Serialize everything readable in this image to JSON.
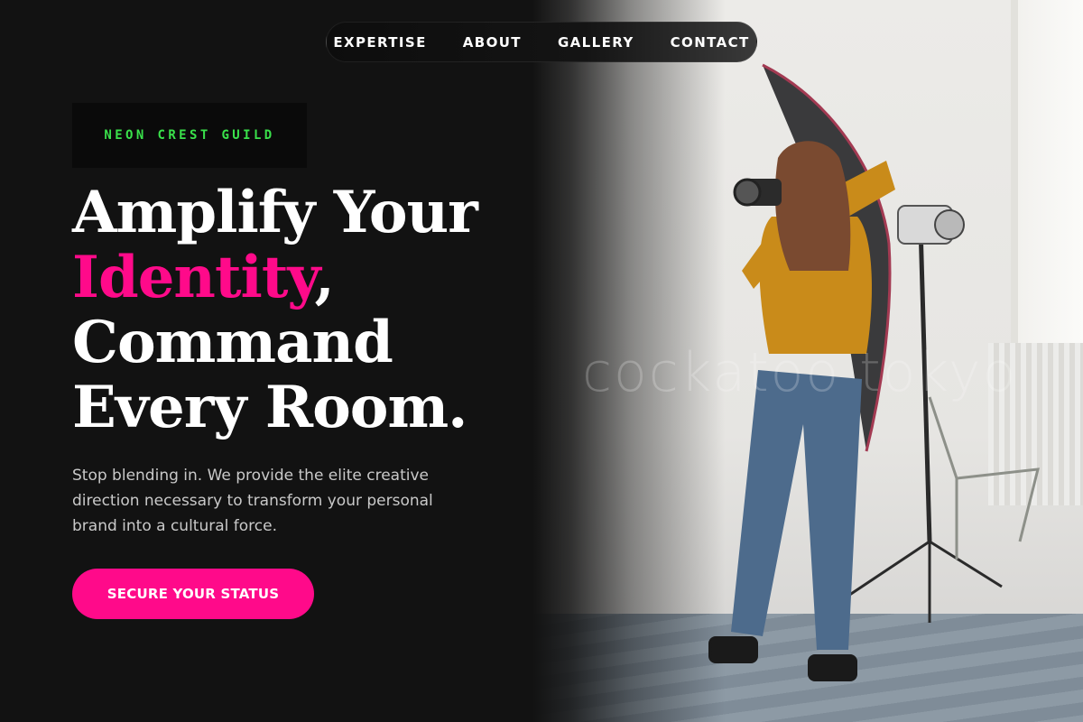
{
  "nav": {
    "items": [
      "EXPERTISE",
      "ABOUT",
      "GALLERY",
      "CONTACT"
    ]
  },
  "hero": {
    "badge": "NEON CREST GUILD",
    "headline": {
      "line1": "Amplify Your",
      "accent": "Identity",
      "comma": ",",
      "line3": "Command",
      "line4": "Every Room."
    },
    "subtext": "Stop blending in. We provide the elite creative direction necessary to transform your personal brand into a cultural force.",
    "cta": "SECURE YOUR STATUS"
  },
  "photo": {
    "watermark": "cockatoo tokyo"
  },
  "colors": {
    "background": "#121212",
    "accent_pink": "#ff0a8a",
    "accent_green": "#3ae14b",
    "text": "#ffffff"
  }
}
